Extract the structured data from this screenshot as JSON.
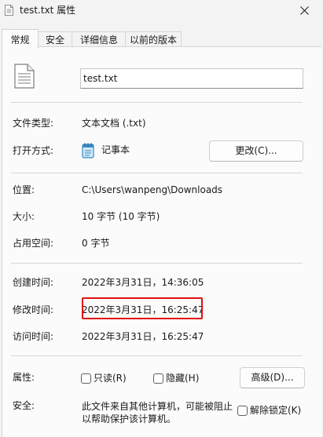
{
  "window": {
    "title": "test.txt 属性"
  },
  "tabs": [
    {
      "label": "常规",
      "active": true
    },
    {
      "label": "安全",
      "active": false
    },
    {
      "label": "详细信息",
      "active": false
    },
    {
      "label": "以前的版本",
      "active": false
    }
  ],
  "general": {
    "filename": "test.txt",
    "file_type_label": "文件类型:",
    "file_type_value": "文本文档 (.txt)",
    "open_with_label": "打开方式:",
    "open_with_app": "记事本",
    "change_button": "更改(C)...",
    "location_label": "位置:",
    "location_value": "C:\\Users\\wanpeng\\Downloads",
    "size_label": "大小:",
    "size_value": "10 字节 (10 字节)",
    "size_on_disk_label": "占用空间:",
    "size_on_disk_value": "0 字节",
    "created_label": "创建时间:",
    "created_value": "2022年3月31日，14:36:05",
    "modified_label": "修改时间:",
    "modified_value": "2022年3月31日，16:25:47",
    "accessed_label": "访问时间:",
    "accessed_value": "2022年3月31日，16:25:47",
    "attributes_label": "属性:",
    "readonly_label": "只读(R)",
    "readonly_checked": false,
    "hidden_label": "隐藏(H)",
    "hidden_checked": false,
    "advanced_button": "高级(D)...",
    "security_label": "安全:",
    "security_text": "此文件来自其他计算机，可能被阻止以帮助保护该计算机。",
    "unblock_label": "解除锁定(K)",
    "unblock_checked": false
  },
  "colors": {
    "highlight": "#e01010",
    "window_bg": "#f3f3f3",
    "panel_bg": "#fbfbfb"
  }
}
